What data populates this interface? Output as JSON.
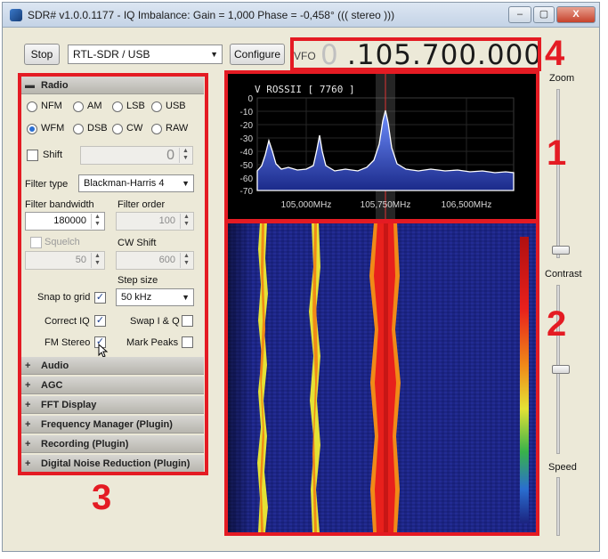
{
  "window": {
    "title": "SDR# v1.0.0.1177 - IQ Imbalance: Gain = 1,000 Phase = -0,458° ((( stereo )))",
    "min_glyph": "–",
    "max_glyph": "▢",
    "close_glyph": "X"
  },
  "toolbar": {
    "stop_label": "Stop",
    "source_value": "RTL-SDR / USB",
    "configure_label": "Configure",
    "vfo_label": "VFO",
    "vfo_leading": "0",
    "vfo_value": ".105.700.000"
  },
  "annotations": [
    "1",
    "2",
    "3",
    "4"
  ],
  "radio": {
    "header": "Radio",
    "modes": [
      "NFM",
      "AM",
      "LSB",
      "USB",
      "WFM",
      "DSB",
      "CW",
      "RAW"
    ],
    "selected_mode": "WFM",
    "shift_label": "Shift",
    "shift_value": "0",
    "filter_type_label": "Filter type",
    "filter_type_value": "Blackman-Harris 4",
    "filter_bandwidth_label": "Filter bandwidth",
    "filter_bandwidth_value": "180000",
    "filter_order_label": "Filter order",
    "filter_order_value": "100",
    "squelch_label": "Squelch",
    "squelch_value": "50",
    "cw_shift_label": "CW Shift",
    "cw_shift_value": "600",
    "step_size_label": "Step size",
    "step_size_value": "50 kHz",
    "snap_label": "Snap to grid",
    "correct_iq_label": "Correct IQ",
    "swap_iq_label": "Swap I & Q",
    "fm_stereo_label": "FM Stereo",
    "mark_peaks_label": "Mark Peaks",
    "check_glyph": "✓"
  },
  "sections": [
    "Audio",
    "AGC",
    "FFT Display",
    "Frequency Manager (Plugin)",
    "Recording (Plugin)",
    "Digital Noise Reduction (Plugin)"
  ],
  "spectrum": {
    "station": "V ROSSII [ 7760 ]",
    "db_ticks": [
      "0",
      "-10",
      "-20",
      "-30",
      "-40",
      "-50",
      "-60",
      "-70"
    ],
    "freq_ticks": [
      "105,000MHz",
      "105,750MHz",
      "106,500MHz"
    ]
  },
  "sidebar": {
    "zoom_label": "Zoom",
    "contrast_label": "Contrast",
    "speed_label": "Speed"
  },
  "colors": {
    "annotation_red": "#e41b23",
    "spectrum_trace": "#ffffff",
    "spectrum_fill": "#2c4fc0",
    "waterfall_bg": "#1b237f",
    "waterfall_hot": "#e8201c",
    "waterfall_mid": "#e4e235"
  }
}
